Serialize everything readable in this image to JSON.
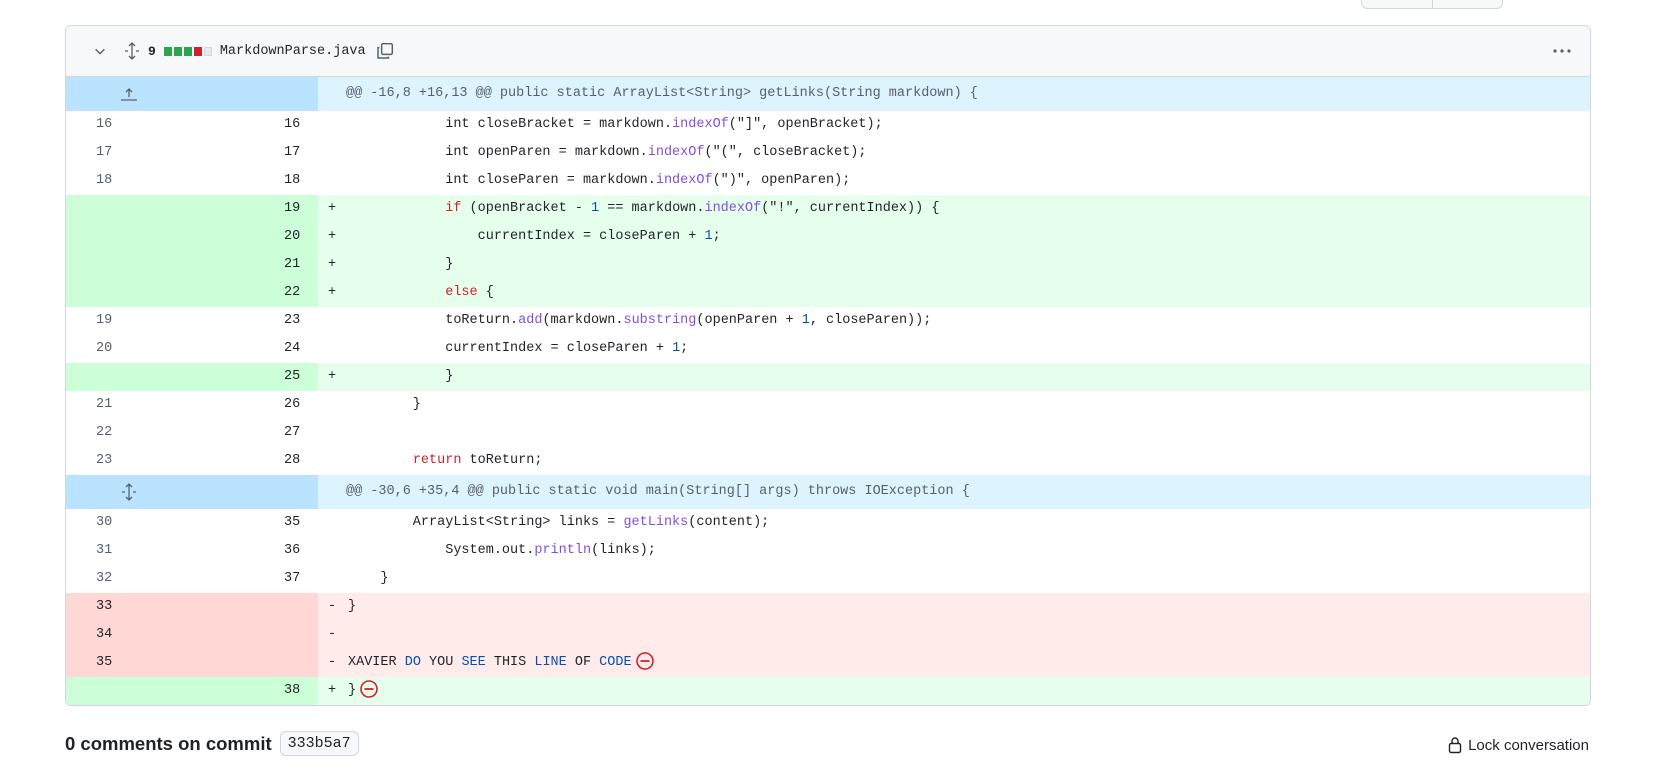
{
  "file": {
    "change_count": "9",
    "filename": "MarkdownParse.java",
    "diffstat": [
      "add",
      "add",
      "add",
      "del",
      "neu"
    ]
  },
  "hunks": [
    {
      "header": "@@ -16,8 +16,13 @@ public static ArrayList<String> getLinks(String markdown) {"
    },
    {
      "header": "@@ -30,6 +35,4 @@ public static void main(String[] args) throws IOException {"
    }
  ],
  "lines1": [
    {
      "type": "ctx",
      "old": "16",
      "new": "16",
      "parts": [
        [
          "",
          "            int closeBracket = markdown."
        ],
        [
          "fn",
          "indexOf"
        ],
        [
          "",
          "(\"]\", openBracket);"
        ]
      ]
    },
    {
      "type": "ctx",
      "old": "17",
      "new": "17",
      "parts": [
        [
          "",
          "            int openParen = markdown."
        ],
        [
          "fn",
          "indexOf"
        ],
        [
          "",
          "(\"(\", closeBracket);"
        ]
      ]
    },
    {
      "type": "ctx",
      "old": "18",
      "new": "18",
      "parts": [
        [
          "",
          "            int closeParen = markdown."
        ],
        [
          "fn",
          "indexOf"
        ],
        [
          "",
          "(\")\", openParen);"
        ]
      ]
    },
    {
      "type": "add",
      "old": "",
      "new": "19",
      "parts": [
        [
          "",
          "            "
        ],
        [
          "kw",
          "if"
        ],
        [
          "",
          " (openBracket - "
        ],
        [
          "nm",
          "1"
        ],
        [
          "",
          " == markdown."
        ],
        [
          "fn",
          "indexOf"
        ],
        [
          "",
          "(\"!\", currentIndex)) {"
        ]
      ]
    },
    {
      "type": "add",
      "old": "",
      "new": "20",
      "parts": [
        [
          "",
          "                currentIndex = closeParen + "
        ],
        [
          "nm",
          "1"
        ],
        [
          "",
          ";"
        ]
      ]
    },
    {
      "type": "add",
      "old": "",
      "new": "21",
      "parts": [
        [
          "",
          "            }"
        ]
      ]
    },
    {
      "type": "add",
      "old": "",
      "new": "22",
      "parts": [
        [
          "",
          "            "
        ],
        [
          "kw",
          "else"
        ],
        [
          "",
          " {"
        ]
      ]
    },
    {
      "type": "ctx",
      "old": "19",
      "new": "23",
      "parts": [
        [
          "",
          "            toReturn."
        ],
        [
          "fn",
          "add"
        ],
        [
          "",
          "(markdown."
        ],
        [
          "fn",
          "substring"
        ],
        [
          "",
          "(openParen + "
        ],
        [
          "nm",
          "1"
        ],
        [
          "",
          ", closeParen));"
        ]
      ]
    },
    {
      "type": "ctx",
      "old": "20",
      "new": "24",
      "parts": [
        [
          "",
          "            currentIndex = closeParen + "
        ],
        [
          "nm",
          "1"
        ],
        [
          "",
          ";"
        ]
      ]
    },
    {
      "type": "add",
      "old": "",
      "new": "25",
      "parts": [
        [
          "",
          "            }"
        ]
      ]
    },
    {
      "type": "ctx",
      "old": "21",
      "new": "26",
      "parts": [
        [
          "",
          "        }"
        ]
      ]
    },
    {
      "type": "ctx",
      "old": "22",
      "new": "27",
      "parts": [
        [
          "",
          ""
        ]
      ]
    },
    {
      "type": "ctx",
      "old": "23",
      "new": "28",
      "parts": [
        [
          "",
          "        "
        ],
        [
          "kw",
          "return"
        ],
        [
          "",
          " toReturn;"
        ]
      ]
    }
  ],
  "lines2": [
    {
      "type": "ctx",
      "old": "30",
      "new": "35",
      "parts": [
        [
          "",
          "        ArrayList<String> links = "
        ],
        [
          "fn",
          "getLinks"
        ],
        [
          "",
          "(content);"
        ]
      ]
    },
    {
      "type": "ctx",
      "old": "31",
      "new": "36",
      "parts": [
        [
          "",
          "            System.out."
        ],
        [
          "fn",
          "println"
        ],
        [
          "",
          "(links);"
        ]
      ]
    },
    {
      "type": "ctx",
      "old": "32",
      "new": "37",
      "parts": [
        [
          "",
          "    }"
        ]
      ]
    },
    {
      "type": "del",
      "old": "33",
      "new": "",
      "parts": [
        [
          "",
          "}"
        ]
      ]
    },
    {
      "type": "del",
      "old": "34",
      "new": "",
      "parts": [
        [
          "",
          ""
        ]
      ]
    },
    {
      "type": "del",
      "old": "35",
      "new": "",
      "ws": true,
      "parts": [
        [
          "",
          "XAVIER "
        ],
        [
          "nm",
          "DO"
        ],
        [
          "",
          " YOU "
        ],
        [
          "nm",
          "SEE"
        ],
        [
          "",
          " THIS "
        ],
        [
          "nm",
          "LINE"
        ],
        [
          "",
          " OF "
        ],
        [
          "nm",
          "CODE"
        ]
      ]
    },
    {
      "type": "add",
      "old": "",
      "new": "38",
      "ws": true,
      "parts": [
        [
          "",
          "}"
        ]
      ]
    }
  ],
  "comments": {
    "label": "0 comments on commit",
    "sha": "333b5a7"
  },
  "lock": {
    "label": "Lock conversation"
  }
}
